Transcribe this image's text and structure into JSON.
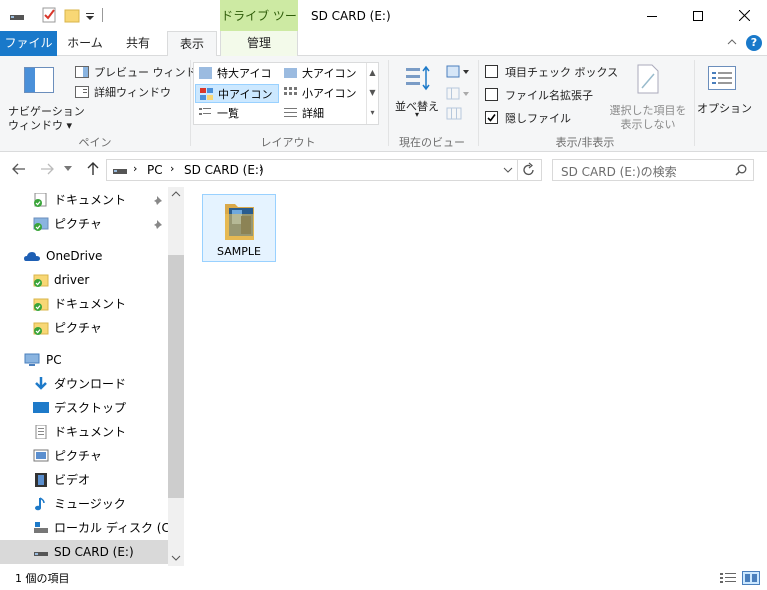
{
  "titlebar": {
    "context_tab_title": "ドライブ ツール",
    "window_title": "SD CARD (E:)"
  },
  "tabs": {
    "file": "ファイル",
    "home": "ホーム",
    "share": "共有",
    "view": "表示",
    "manage": "管理"
  },
  "ribbon": {
    "panes": {
      "nav_pane_line1": "ナビゲーション",
      "nav_pane_line2": "ウィンドウ",
      "preview_pane": "プレビュー ウィンドウ",
      "details_pane": "詳細ウィンドウ",
      "group_label": "ペイン"
    },
    "layout": {
      "extra_large": "特大アイコン",
      "large": "大アイコン",
      "medium": "中アイコン",
      "small": "小アイコン",
      "list": "一覧",
      "details": "詳細",
      "group_label": "レイアウト"
    },
    "current_view": {
      "sort_by": "並べ替え",
      "group_label": "現在のビュー"
    },
    "show_hide": {
      "item_check_boxes": "項目チェック ボックス",
      "file_name_extensions": "ファイル名拡張子",
      "hidden_items": "隠しファイル",
      "hide_selected_line1": "選択した項目を",
      "hide_selected_line2": "表示しない",
      "group_label": "表示/非表示"
    },
    "options": "オプション"
  },
  "address": {
    "crumbs": [
      "PC",
      "SD CARD (E:)"
    ],
    "search_placeholder": "SD CARD (E:)の検索"
  },
  "nav": {
    "items": [
      {
        "label": "ドキュメント",
        "icon": "documents-icon"
      },
      {
        "label": "ピクチャ",
        "icon": "pictures-icon"
      },
      {
        "label": "OneDrive",
        "icon": "onedrive-icon"
      },
      {
        "label": "driver",
        "icon": "folder-icon"
      },
      {
        "label": "ドキュメント",
        "icon": "folder-icon"
      },
      {
        "label": "ピクチャ",
        "icon": "folder-icon"
      },
      {
        "label": "PC",
        "icon": "pc-icon"
      },
      {
        "label": "ダウンロード",
        "icon": "download-icon"
      },
      {
        "label": "デスクトップ",
        "icon": "desktop-icon"
      },
      {
        "label": "ドキュメント",
        "icon": "documents-icon"
      },
      {
        "label": "ピクチャ",
        "icon": "pictures-icon"
      },
      {
        "label": "ビデオ",
        "icon": "video-icon"
      },
      {
        "label": "ミュージック",
        "icon": "music-icon"
      },
      {
        "label": "ローカル ディスク (C:)",
        "icon": "local-disk-icon"
      },
      {
        "label": "SD CARD (E:)",
        "icon": "sd-card-icon"
      }
    ]
  },
  "content": {
    "items": [
      {
        "name": "SAMPLE",
        "icon": "folder-icon"
      }
    ]
  },
  "status": {
    "item_count": "1 個の項目"
  },
  "colors": {
    "file_tab": "#1979ca",
    "context_tab": "#cdeaa3",
    "selection": "#cce8ff"
  }
}
